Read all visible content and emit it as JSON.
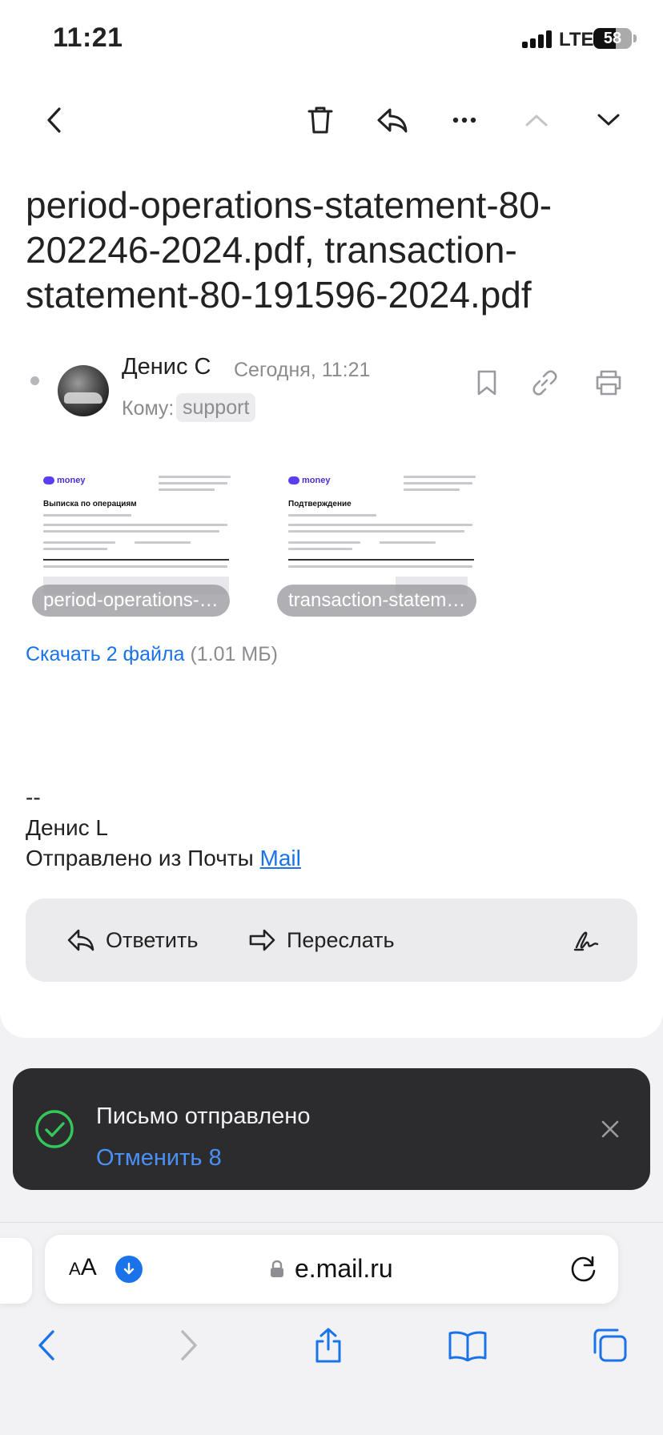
{
  "status_bar": {
    "time": "11:21",
    "network": "LTE",
    "battery": "58",
    "battery_fraction": 0.58
  },
  "toolbar": {
    "back_icon": "chevron-left-icon",
    "delete_icon": "trash-icon",
    "reply_icon": "reply-icon",
    "more_icon": "more-horizontal-icon",
    "prev_icon": "chevron-up-icon",
    "next_icon": "chevron-down-icon"
  },
  "email": {
    "subject": "period-operations-statement-80-202246-2024.pdf, transaction-statement-80-191596-2024.pdf",
    "sender": "Денис С",
    "date": "Сегодня, 11:21",
    "to_label": "Кому:",
    "to": "support",
    "actions": [
      "bookmark-icon",
      "link-icon",
      "printer-icon"
    ]
  },
  "attachments": [
    {
      "name": "period-operations-statement-80-202246-2024.pdf",
      "chip": "period-operations-…",
      "logo": "money",
      "doc_title": "Выписка по операциям"
    },
    {
      "name": "transaction-statement-80-191596-2024.pdf",
      "chip": "transaction-statem…",
      "logo": "money",
      "doc_title": "Подтверждение"
    }
  ],
  "download": {
    "label": "Скачать 2 файла",
    "size": "(1.01 МБ)"
  },
  "signature": {
    "dash": "--",
    "name": "Денис L",
    "sent_prefix": "Отправлено из Почты ",
    "sent_link": "Mail"
  },
  "reply_bar": {
    "reply": "Ответить",
    "forward": "Переслать",
    "signature_icon": "signature-icon"
  },
  "toast": {
    "title": "Письмо отправлено",
    "undo": "Отменить 8",
    "icon": "check-circle-icon",
    "close_icon": "close-icon"
  },
  "browser": {
    "aa_small": "A",
    "aa_large": "A",
    "domain": "e.mail.ru",
    "nav": [
      "back-icon",
      "forward-icon",
      "share-icon",
      "bookmarks-icon",
      "tabs-icon"
    ]
  },
  "colors": {
    "accent": "#1a73e8",
    "toast_bg": "#2c2c2e",
    "success": "#34c759",
    "undo": "#4a90f5"
  }
}
